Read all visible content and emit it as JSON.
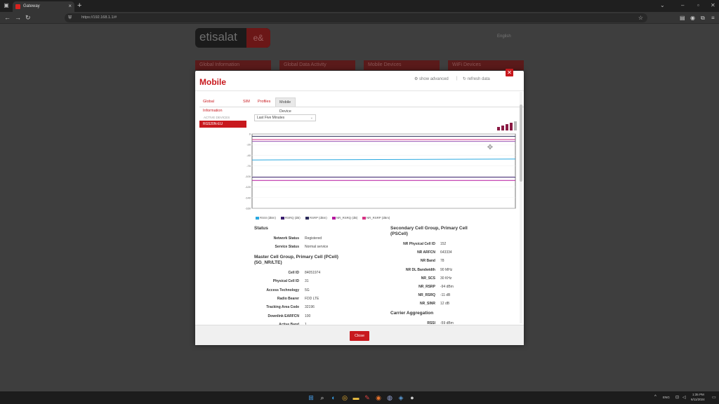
{
  "browser": {
    "tab_title": "Gateway",
    "url": "https://192.168.1.1/#",
    "new_tab": "+",
    "close": "×"
  },
  "page_bg": {
    "logo_text": "etisalat",
    "logo_badge": "e&",
    "lang": "English",
    "tabs": [
      "Global Information",
      "Global Data Activity",
      "Mobile Devices",
      "WiFi Devices"
    ]
  },
  "modal": {
    "title": "Mobile",
    "show_advanced": "show advanced",
    "separator": "|",
    "refresh": "refresh data",
    "close_x": "✕",
    "tabs": [
      "Global Information",
      "SIM",
      "Profiles",
      "Mobile Device"
    ],
    "active_tab": 3,
    "active_devices_label": "ACTIVE DEVICES",
    "device": "RG520N-EU",
    "time_range": "Last Five Minutes",
    "close_button": "Close"
  },
  "chart_data": {
    "type": "line",
    "x": [
      0,
      1
    ],
    "ylim": [
      -160,
      0
    ],
    "y_ticks": [
      "0",
      "-20",
      "-40",
      "-70",
      "-100",
      "-120",
      "-140",
      "-160"
    ],
    "series": [
      {
        "name": "RSSI (dBm)",
        "color": "#29a8e0",
        "values": [
          -56,
          -54
        ]
      },
      {
        "name": "RSRQ (dB)",
        "color": "#3a1d6e",
        "values": [
          -93,
          -93
        ]
      },
      {
        "name": "RSRP (dBm)",
        "color": "#2b2b5a",
        "values": [
          -5,
          -5
        ]
      },
      {
        "name": "NR_RSRQ (dB)",
        "color": "#b5179e",
        "values": [
          -100,
          -100
        ]
      },
      {
        "name": "NR_RSRP (dBm)",
        "color": "#d63384",
        "values": [
          -12,
          -12
        ]
      }
    ],
    "extra_lines": [
      {
        "color": "#9b59b6",
        "values": [
          -16,
          -16
        ]
      }
    ]
  },
  "status": {
    "title": "Status",
    "rows": [
      {
        "label": "Network Status",
        "value": "Registered"
      },
      {
        "label": "Service Status",
        "value": "Normal service"
      }
    ]
  },
  "master_cell": {
    "title": "Master Cell Group, Primary Cell (PCell) (5G_NR/LTE)",
    "rows": [
      {
        "label": "Cell ID",
        "value": "84051974"
      },
      {
        "label": "Physical Cell ID",
        "value": "31"
      },
      {
        "label": "Access Technology",
        "value": "5G"
      },
      {
        "label": "Radio Bearer",
        "value": "FDD LTE"
      },
      {
        "label": "Tracking Area Code",
        "value": "32196"
      },
      {
        "label": "Downlink EARFCN",
        "value": "100"
      },
      {
        "label": "Active Band",
        "value": "1"
      }
    ]
  },
  "secondary_cell": {
    "title": "Secondary Cell Group, Primary Cell (PSCell)",
    "rows": [
      {
        "label": "NR Physical Cell ID",
        "value": "152"
      },
      {
        "label": "NR ARFCN",
        "value": "643334"
      },
      {
        "label": "NR Band",
        "value": "78"
      },
      {
        "label": "NR DL Bandwidth",
        "value": "90 MHz"
      },
      {
        "label": "NR_SCS",
        "value": "30 KHz"
      },
      {
        "label": "NR_RSRP",
        "value": "-94 dBm"
      },
      {
        "label": "NR_RSRQ",
        "value": "-11 dB"
      },
      {
        "label": "NR_SINR",
        "value": "12 dB"
      }
    ]
  },
  "carrier_agg": {
    "title": "Carrier Aggregation",
    "rows": [
      {
        "label": "RSSI",
        "value": "-59 dBm"
      }
    ]
  },
  "taskbar": {
    "lang": "ENG",
    "time": "1:35 PM",
    "date": "6/11/2024",
    "tray_arrow": "^"
  },
  "colors": {
    "brand_red": "#c8191e",
    "signal": "#8a1a44"
  }
}
